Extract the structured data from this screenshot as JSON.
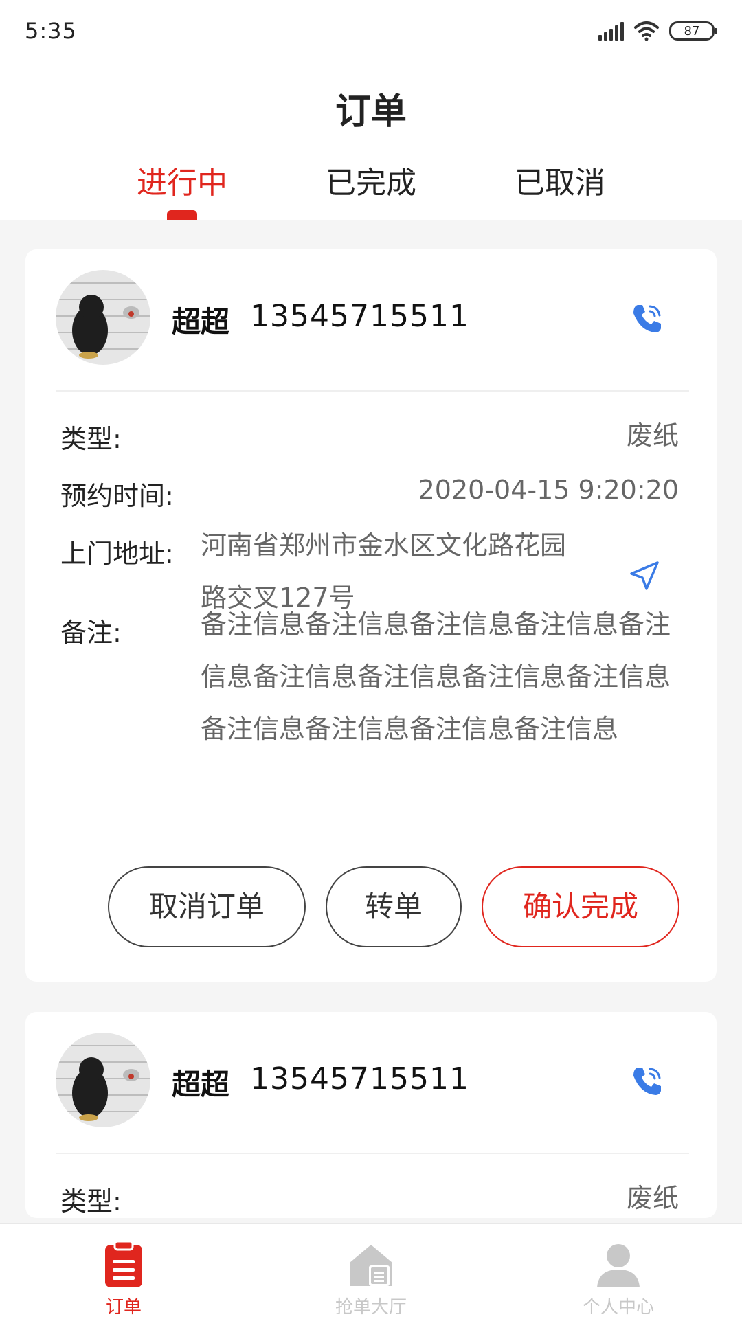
{
  "status_bar": {
    "time": "5:35",
    "battery": "87"
  },
  "header": {
    "title": "订单"
  },
  "tabs": [
    {
      "label": "进行中",
      "active": true
    },
    {
      "label": "已完成",
      "active": false
    },
    {
      "label": "已取消",
      "active": false
    }
  ],
  "orders": [
    {
      "name": "超超",
      "phone": "13545715511",
      "type_label": "类型:",
      "type_value": "废纸",
      "time_label": "预约时间:",
      "time_value": "2020-04-15 9:20:20",
      "address_label": "上门地址:",
      "address_value": "河南省郑州市金水区文化路花园路交叉127号",
      "remark_label": "备注:",
      "remark_value": "备注信息备注信息备注信息备注信息备注信息备注信息备注信息备注信息备注信息备注信息备注信息备注信息备注信息",
      "buttons": {
        "cancel": "取消订单",
        "transfer": "转单",
        "confirm": "确认完成"
      }
    },
    {
      "name": "超超",
      "phone": "13545715511",
      "type_label": "类型:",
      "type_value": "废纸"
    }
  ],
  "bottom_nav": [
    {
      "label": "订单",
      "icon": "clipboard-icon",
      "active": true
    },
    {
      "label": "抢单大厅",
      "icon": "house-icon",
      "active": false
    },
    {
      "label": "个人中心",
      "icon": "user-icon",
      "active": false
    }
  ],
  "colors": {
    "accent": "#e0261e",
    "icon_blue": "#3a7be6",
    "inactive": "#c8c8c8"
  }
}
